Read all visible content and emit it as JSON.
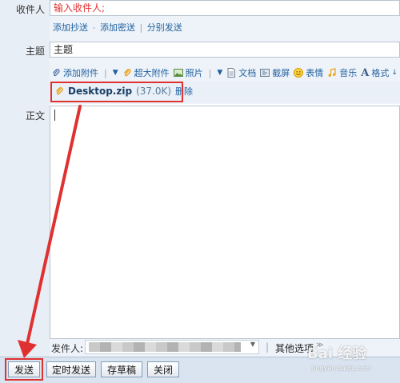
{
  "recipient": {
    "label": "收件人",
    "placeholder": "输入收件人;"
  },
  "add_links": {
    "add_cc": "添加抄送",
    "dash": "-",
    "add_bcc": "添加密送",
    "pipe": "|",
    "separate_send": "分别发送"
  },
  "subject": {
    "label": "主题",
    "value": "主题"
  },
  "toolbar": {
    "add_attachment": "添加附件",
    "large_attachment": "超大附件",
    "photo": "照片",
    "document": "文档",
    "screenshot": "截屏",
    "emoji": "表情",
    "music": "音乐",
    "format": "格式"
  },
  "attachment": {
    "name": "Desktop.zip",
    "size": "(37.0K)",
    "delete": "删除"
  },
  "body": {
    "label": "正文"
  },
  "sender": {
    "label": "发件人:",
    "other_options": "其他选项"
  },
  "buttons": {
    "send": "发送",
    "scheduled_send": "定时发送",
    "save_draft": "存草稿",
    "close": "关闭"
  },
  "watermark": {
    "text": "Bai 经验",
    "url": "jingyan.baidu.com"
  },
  "colors": {
    "highlight": "#e03131",
    "link": "#1f5f9e",
    "toolbar_bg": "#e9f0f8"
  }
}
